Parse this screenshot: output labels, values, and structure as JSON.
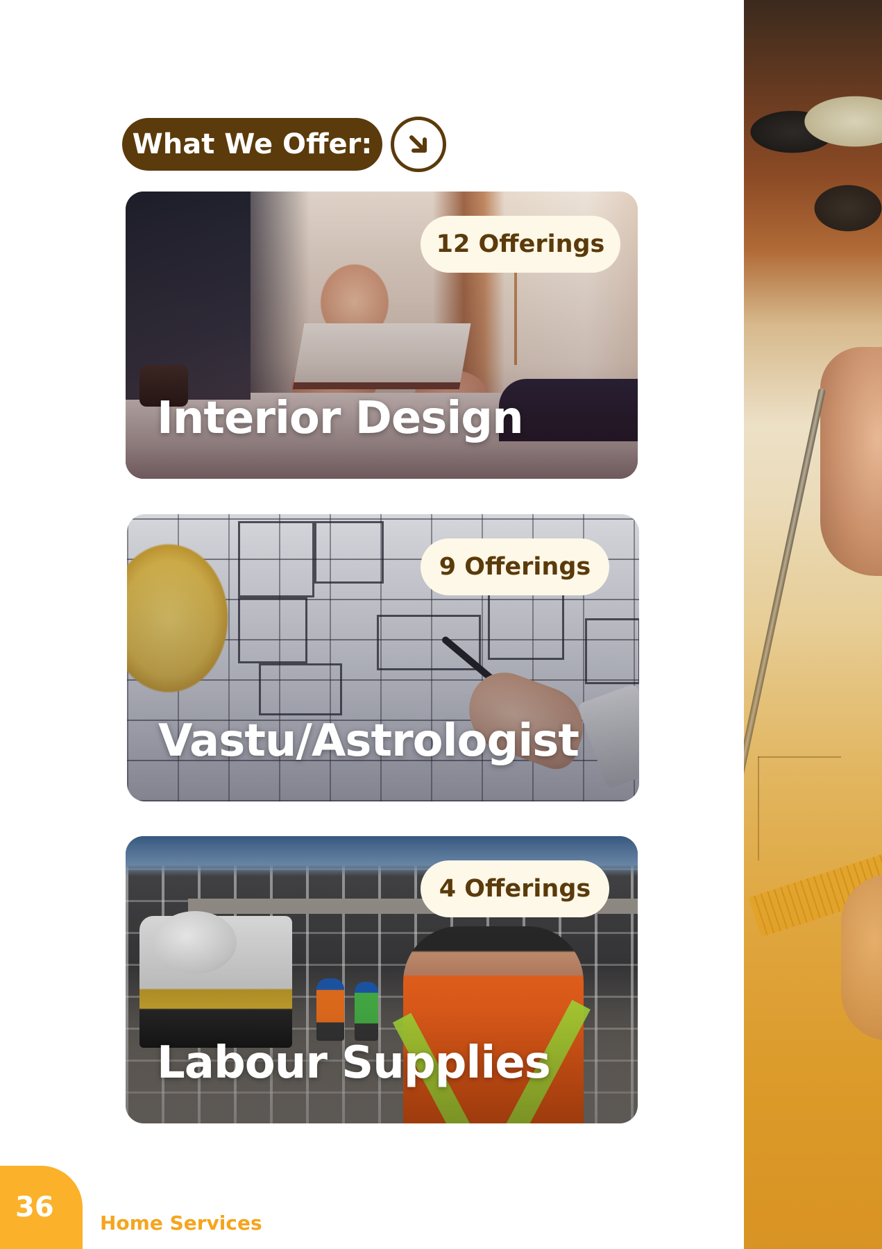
{
  "section": {
    "heading": "What We Offer:",
    "arrow_icon": "arrow-down-right-icon"
  },
  "cards": [
    {
      "title": "Interior Design",
      "badge": "12 Offerings"
    },
    {
      "title": "Vastu/Astrologist",
      "badge": "9 Offerings"
    },
    {
      "title": "Labour Supplies",
      "badge": "4 Offerings"
    }
  ],
  "footer": {
    "page_number": "36",
    "label": "Home Services"
  },
  "colors": {
    "brand_brown": "#5b3a0b",
    "accent_orange": "#fbb12a",
    "badge_bg": "#fdf8e8"
  }
}
